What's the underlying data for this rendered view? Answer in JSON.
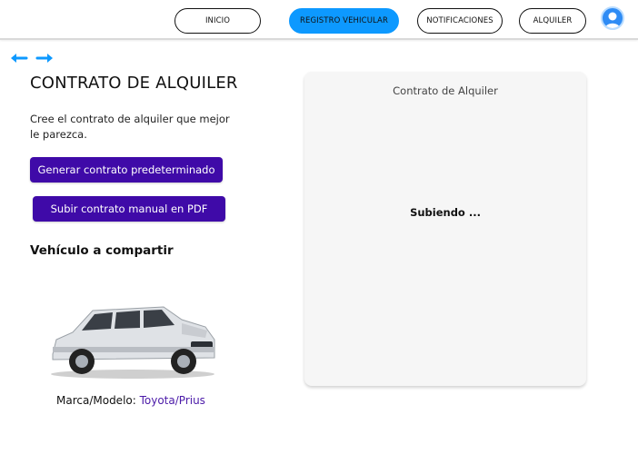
{
  "nav": {
    "inicio": "INICIO",
    "registro": "REGISTRO VEHICULAR",
    "notificaciones": "NOTIFICACIONES",
    "alquiler": "ALQUILER"
  },
  "colors": {
    "accent": "#0d99ff",
    "primary_button": "#3f0aa8",
    "link": "#4b1aa8"
  },
  "icons": {
    "back": "arrow-left-icon",
    "forward": "arrow-right-icon",
    "avatar": "user-avatar-icon"
  },
  "main": {
    "title": "CONTRATO DE ALQUILER",
    "description": "Cree el contrato de alquiler que mejor le parezca.",
    "btn_generate": "Generar contrato predeterminado",
    "btn_upload": "Subir contrato manual en PDF",
    "vehicle_section": "Vehículo a compartir",
    "vehicle_label": "Marca/Modelo: ",
    "vehicle_value": "Toyota/Prius"
  },
  "panel": {
    "title": "Contrato de Alquiler",
    "status": "Subiendo ..."
  }
}
